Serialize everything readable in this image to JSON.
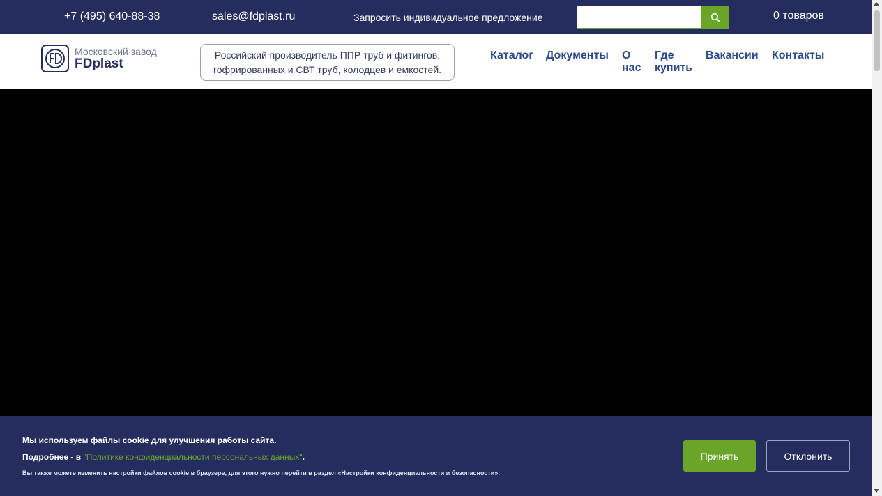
{
  "topbar": {
    "phone": "+7 (495) 640-88-38",
    "email": "sales@fdplast.ru",
    "offer": "Запросить индивидуальное предложение",
    "search_value": "",
    "search_icon": "search-icon",
    "cart": "0 товаров"
  },
  "header": {
    "logo_subtitle": "Московский завод",
    "logo_name": "FDplast",
    "tagline_line1": "Российский производитель ППР труб и фитингов,",
    "tagline_line2": "гофрированных и СВТ труб, колодцев и емкостей.",
    "nav": {
      "catalog": "Каталог",
      "docs": "Документы",
      "about": "О нас",
      "where": "Где купить",
      "vacancy": "Вакансии",
      "contacts": "Контакты"
    }
  },
  "cookie": {
    "line1": "Мы используем файлы cookie для улучшения работы сайта.",
    "line2_prefix": "Подробнее - в ",
    "line2_link": "\"Политике конфиденциальности персональных данных\"",
    "line2_suffix": ".",
    "line3": "Вы также можете изменить настройки файлов cookie в браузере, для этого нужно перейти в раздел «Настройки конфиденциальности и безопасности».",
    "accept": "Принять",
    "decline": "Отклонить"
  },
  "colors": {
    "navy": "#252d5e",
    "green": "#6aa52a",
    "nav_link": "#2e4a8e"
  }
}
